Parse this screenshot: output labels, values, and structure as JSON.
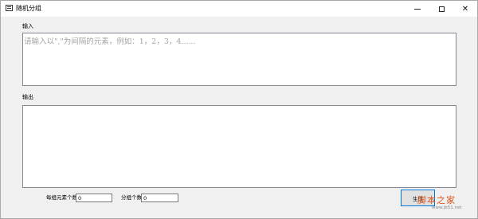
{
  "window": {
    "title": "随机分组",
    "icon": "app-window-icon",
    "controls": {
      "minimize": "minimize-icon",
      "maximize": "☐",
      "close": "✕"
    }
  },
  "input": {
    "label": "输入",
    "placeholder": "请输入以\",\"为间隔的元素，例如：1，2，3，4......",
    "value": ""
  },
  "output": {
    "label": "输出",
    "value": ""
  },
  "controls": {
    "per_group_label": "每组元素个数",
    "per_group_value": "0",
    "groups_label": "分组个数",
    "groups_value": "0",
    "generate_button": "生成"
  },
  "watermark": {
    "title": "脚本之家",
    "url": "www.jb51.net"
  },
  "colors": {
    "window_bg": "#f0f0f0",
    "button_border": "#0078d7",
    "watermark": "#d9541e"
  }
}
